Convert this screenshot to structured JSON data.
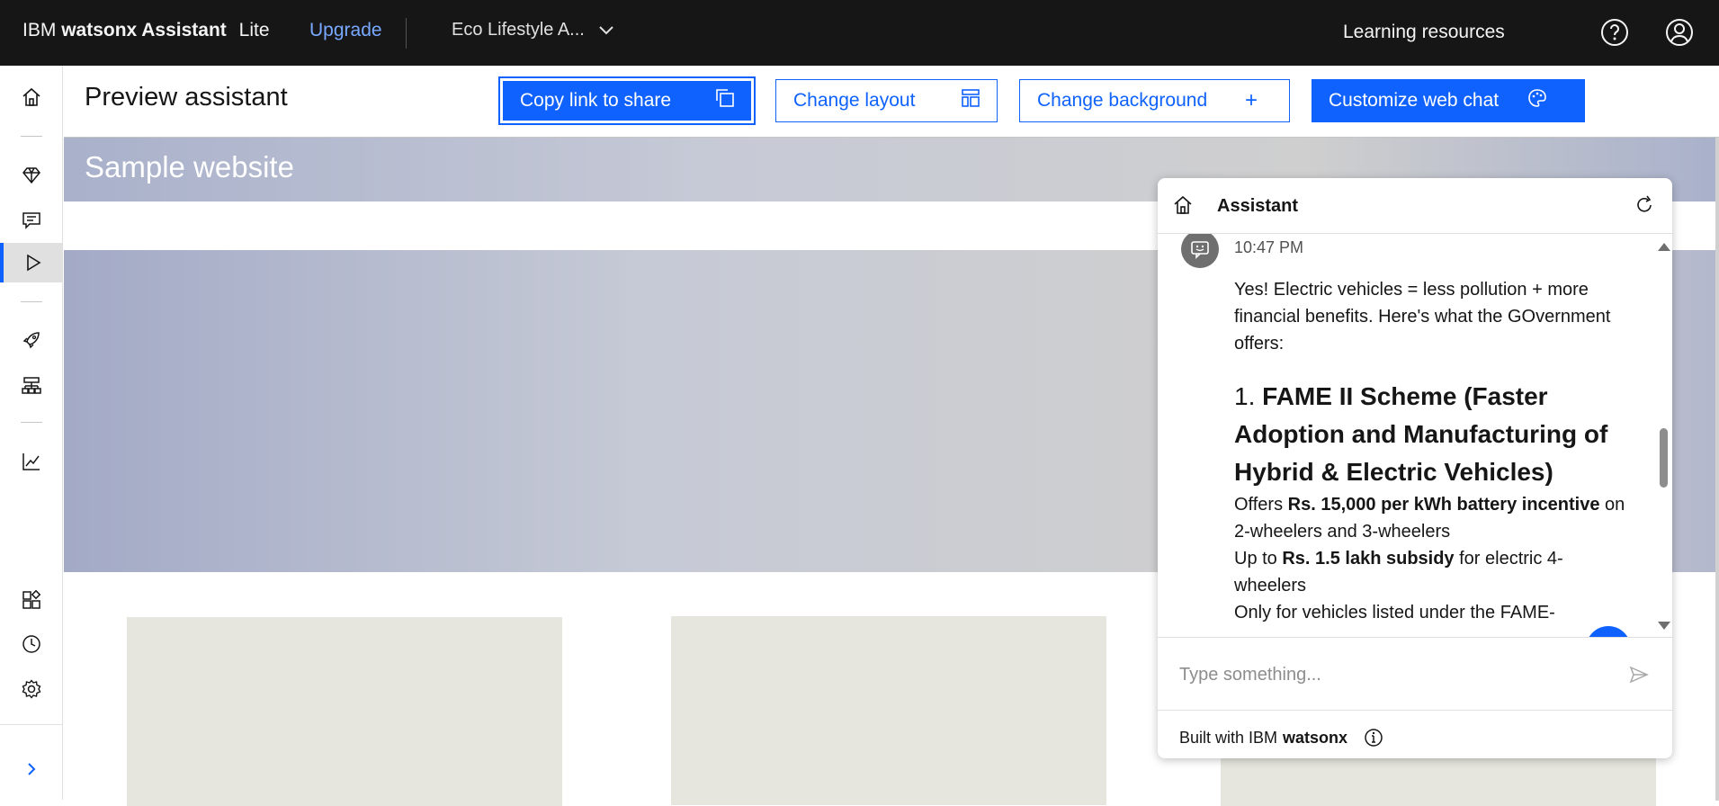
{
  "topbar": {
    "brand_ibm": "IBM",
    "brand_product": "watsonx Assistant",
    "brand_plan": "Lite",
    "upgrade": "Upgrade",
    "assistant_name": "Eco Lifestyle A...",
    "learning_resources": "Learning resources",
    "icons": [
      "help-icon",
      "user-avatar-icon"
    ]
  },
  "siderail": {
    "items": [
      "home-icon",
      "actions-diamond-icon",
      "chat-icon",
      "preview-play-icon",
      "publish-rocket-icon",
      "environments-icon",
      "analytics-icon",
      "integrations-icon",
      "history-icon",
      "settings-icon",
      "expand-chevron-icon"
    ],
    "active": "preview-play-icon"
  },
  "header": {
    "title": "Preview assistant",
    "copy_link": "Copy link to share",
    "change_layout": "Change layout",
    "change_background": "Change background",
    "change_background_icon": "+",
    "customize": "Customize web chat"
  },
  "site": {
    "title": "Sample website"
  },
  "chat": {
    "title": "Assistant",
    "time": "10:47 PM",
    "intro": "Yes! Electric vehicles = less pollution + more financial benefits. Here's what the GOvernment offers:",
    "heading_num": "1.",
    "heading": "FAME II Scheme (Faster Adoption and Manufacturing of Hybrid & Electric Vehicles)",
    "line1_pre": "Offers ",
    "line1_bold": "Rs. 15,000 per kWh battery incentive",
    "line1_post": " on 2-wheelers and 3-wheelers",
    "line2_pre": "Up to ",
    "line2_bold": "Rs. 1.5 lakh subsidy",
    "line2_post": " for electric 4-wheelers",
    "line3": "Only for vehicles listed under the FAME-",
    "help_fab": "?",
    "input_placeholder": "Type something...",
    "footer_pre": "Built with IBM",
    "footer_bold": "watsonx"
  },
  "colors": {
    "accent": "#0f62fe",
    "topbar_bg": "#161616",
    "upgrade_link": "#78a9ff"
  }
}
